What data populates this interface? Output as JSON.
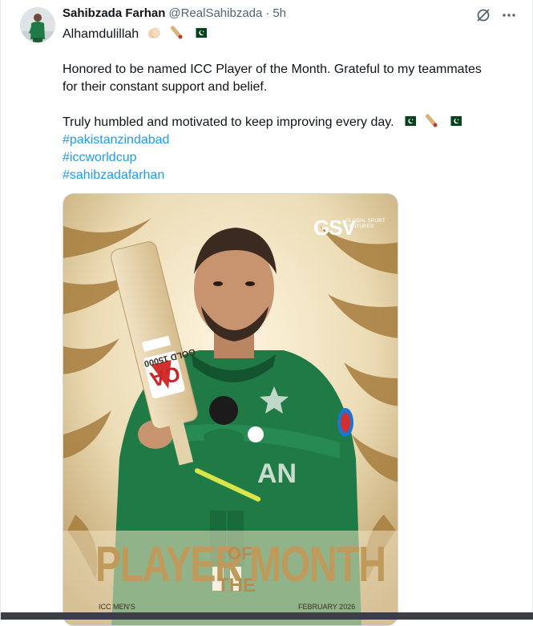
{
  "tweet": {
    "author_name": "Sahibzada Farhan",
    "handle": "@RealSahibzada",
    "separator": "·",
    "time": "5h",
    "lines": {
      "l1": "Alhamdulillah",
      "l2": "Honored to be named ICC Player of the Month. Grateful to my teammates",
      "l3": "for their constant support and belief.",
      "l4": "Truly humbled and motivated to keep improving every day."
    },
    "hashtags": [
      "#pakistanzindabad",
      "#iccworldcup",
      "#sahibzadafarhan"
    ]
  },
  "icons": {
    "grok": "grok-icon",
    "more": "more-icon",
    "clap": "clap-emoji",
    "bat": "cricket-bat-emoji",
    "flag": "pakistan-flag-emoji"
  },
  "poster": {
    "brand": "GSV",
    "brand_sub": "GLOBAL SPORT VENTURES",
    "bat_brand": "CA",
    "bat_model": "GOLD 15000",
    "jersey_letters": "AN",
    "title_player": "PLAYER",
    "title_of": "OF",
    "title_the": "THE",
    "title_month": "MONTH",
    "footer_left": "ICC MEN'S",
    "footer_right": "FEBRUARY 2026"
  },
  "colors": {
    "hashtag": "#1d9bf0",
    "muted": "#536471",
    "gold": "#c09a5a",
    "jersey": "#1f7a46"
  }
}
